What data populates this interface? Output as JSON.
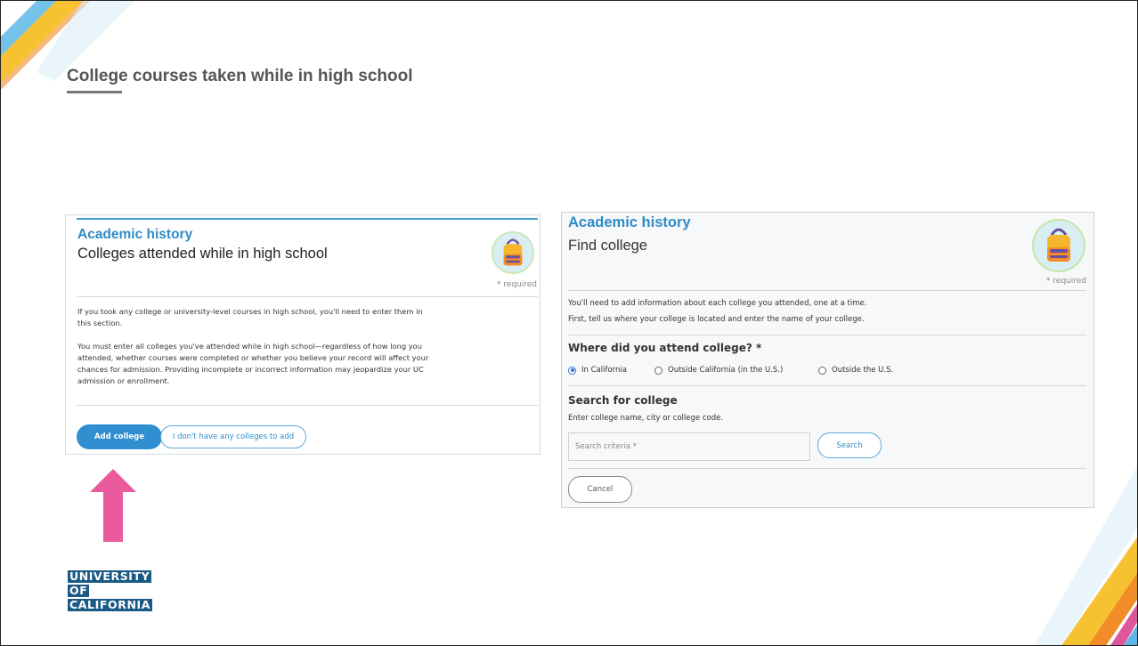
{
  "slide": {
    "title": "College courses taken while in high school"
  },
  "left_panel": {
    "kicker": "Academic history",
    "heading": "Colleges attended while in high school",
    "required_note": "* required",
    "paragraph1": "If you took any college or university-level courses in high school, you'll need to enter them in this section.",
    "paragraph2": "You must enter all colleges you've attended while in high school—regardless of how long you attended, whether courses were completed or whether you believe your record will affect your chances for admission. Providing incomplete or incorrect information may jeopardize your UC admission or enrollment.",
    "add_button": "Add college",
    "none_button": "I don't have any colleges to add"
  },
  "right_panel": {
    "kicker": "Academic history",
    "heading": "Find college",
    "required_note": "* required",
    "intro_line1": "You'll need to add information about each college you attended, one at a time.",
    "intro_line2": "First, tell us where your college is located and enter the name of your college.",
    "where_question": "Where did you attend college? *",
    "radio_options": [
      {
        "label": "In California",
        "selected": true
      },
      {
        "label": "Outside California (in the U.S.)",
        "selected": false
      },
      {
        "label": "Outside the U.S.",
        "selected": false
      }
    ],
    "search_heading": "Search for college",
    "search_hint": "Enter college name, city or college code.",
    "search_placeholder": "Search criteria *",
    "search_button": "Search",
    "cancel_button": "Cancel"
  },
  "logo": {
    "line1": "UNIVERSITY",
    "line2": "OF",
    "line3": "CALIFORNIA"
  },
  "icons": {
    "arrow": "up-arrow-icon",
    "avatar": "backpack-icon"
  },
  "colors": {
    "accent_blue": "#2f8fd1",
    "arrow_pink": "#ea5a9d",
    "logo_blue": "#1c5a86",
    "deco_yellow": "#f6c232",
    "deco_orange": "#f28c28",
    "deco_light_blue": "#5db8e8"
  }
}
